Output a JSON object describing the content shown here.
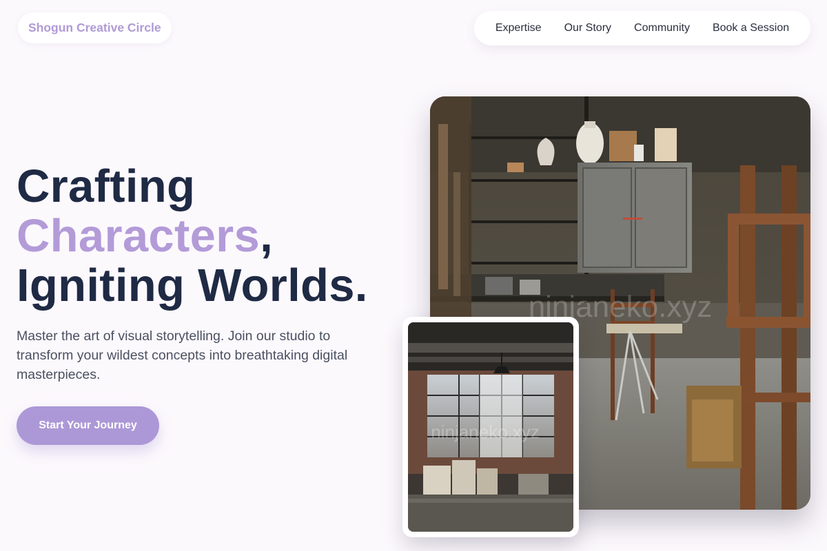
{
  "brand": {
    "name": "Shogun Creative Circle"
  },
  "nav": {
    "items": [
      "Expertise",
      "Our Story",
      "Community",
      "Book a Session"
    ]
  },
  "hero": {
    "headline_line1": "Crafting",
    "headline_accent": "Characters",
    "headline_comma": ",",
    "headline_line3": "Igniting Worlds.",
    "lead": "Master the art of visual storytelling. Join our studio to transform your wildest concepts into breathtaking digital masterpieces.",
    "cta_label": "Start Your Journey"
  },
  "images": {
    "main_watermark": "ninjaneko.xyz",
    "small_watermark": "ninjaneko.xyz"
  },
  "colors": {
    "background": "#fcf9fd",
    "accent": "#b39bd8",
    "heading": "#1f2a44",
    "body_text": "#4a5061",
    "cta": "#ac98d6"
  }
}
